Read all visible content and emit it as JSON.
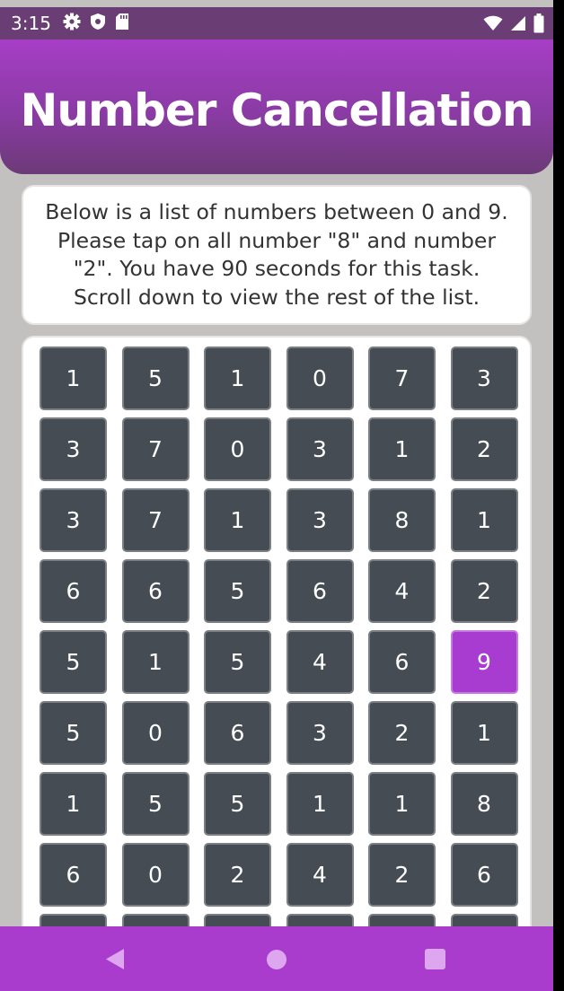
{
  "status_bar": {
    "time": "3:15",
    "left_icons": [
      "gear-icon",
      "shield-icon",
      "sd-card-icon"
    ],
    "right_icons": [
      "wifi-icon",
      "signal-icon",
      "battery-icon"
    ]
  },
  "header": {
    "title": "Number Cancellation"
  },
  "instructions": {
    "text": "Below is a list of numbers between 0 and 9. Please tap on all number \"8\" and number \"2\". You have 90 seconds for this task. Scroll down to view the rest of the list."
  },
  "grid": {
    "rows": [
      [
        "1",
        "5",
        "1",
        "0",
        "7",
        "3"
      ],
      [
        "3",
        "7",
        "0",
        "3",
        "1",
        "2"
      ],
      [
        "3",
        "7",
        "1",
        "3",
        "8",
        "1"
      ],
      [
        "6",
        "6",
        "5",
        "6",
        "4",
        "2"
      ],
      [
        "5",
        "1",
        "5",
        "4",
        "6",
        "9"
      ],
      [
        "5",
        "0",
        "6",
        "3",
        "2",
        "1"
      ],
      [
        "1",
        "5",
        "5",
        "1",
        "1",
        "8"
      ],
      [
        "6",
        "0",
        "2",
        "4",
        "2",
        "6"
      ],
      [
        "",
        "",
        "",
        "",
        "",
        ""
      ]
    ],
    "selected": [
      [
        4,
        5
      ]
    ]
  },
  "colors": {
    "accent": "#a93cd0",
    "button": "#454c53",
    "header_top": "#a63ec6",
    "header_bottom": "#6c3a77",
    "background": "#c3c0c0"
  },
  "nav_bar": {
    "icons": [
      "back-icon",
      "home-icon",
      "recent-apps-icon"
    ]
  }
}
